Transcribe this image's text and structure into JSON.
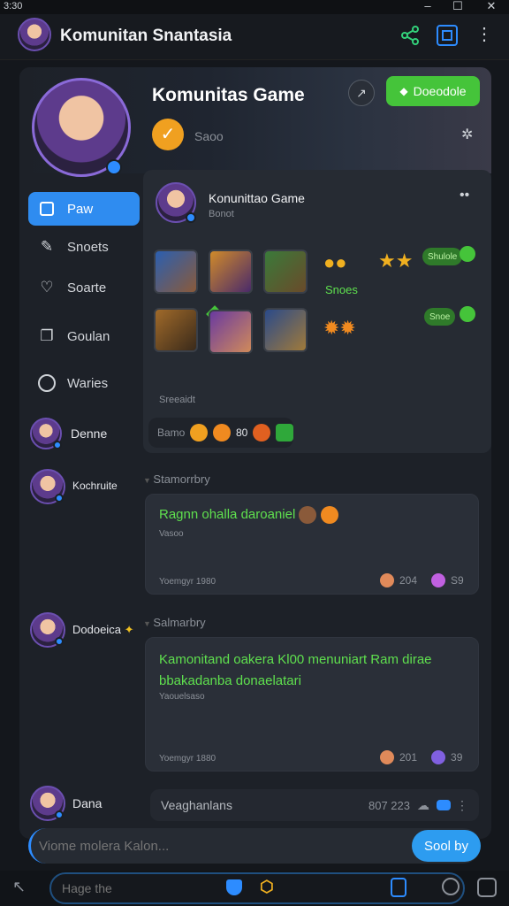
{
  "titlebar": {
    "time": "3:30",
    "min": "–",
    "max": "☐",
    "close": "✕"
  },
  "header": {
    "title": "Komunitan Snantasia"
  },
  "hero": {
    "title": "Komunitas Game",
    "subtitle": "Saoo",
    "join_label": "Doeodole"
  },
  "sidebar": {
    "items": [
      {
        "label": "Paw"
      },
      {
        "label": "Snoets"
      },
      {
        "label": "Soarte"
      },
      {
        "label": "Goulan"
      },
      {
        "label": "Waries"
      }
    ]
  },
  "feed_card": {
    "title": "Konunittao Game",
    "sub": "Bonot",
    "stars_label": "Snoes",
    "pill1": "Shulole",
    "pill2": "Snoe",
    "footer_label": "Sreeaidt",
    "reaction_text": "Bamo",
    "reaction_count": "80"
  },
  "members": [
    {
      "name": "Denne"
    },
    {
      "name": "Kochruite"
    },
    {
      "name": "Dodoeica"
    },
    {
      "name": "Dana"
    }
  ],
  "posts": [
    {
      "header": "Stamorrbry",
      "text": "Ragnn ohalla daroaniel",
      "sub": "Vasoo",
      "time": "Yoemgyr 1980",
      "likes": "204",
      "shares": "S9"
    },
    {
      "header": "Salmarbry",
      "text": "Kamonitand oakera Kl00 menuniart Ram dirae bbakadanba donaelatari",
      "sub": "Yaouelsaso",
      "time": "Yoemgyr 1880",
      "likes": "201",
      "shares": "39"
    }
  ],
  "input_row": {
    "label": "Veaghanlans",
    "count": "807 223"
  },
  "composer": {
    "placeholder": "Viome molera Kalon...",
    "send_label": "Sool by"
  },
  "bottom_bar": {
    "search_placeholder": "Hage the"
  }
}
